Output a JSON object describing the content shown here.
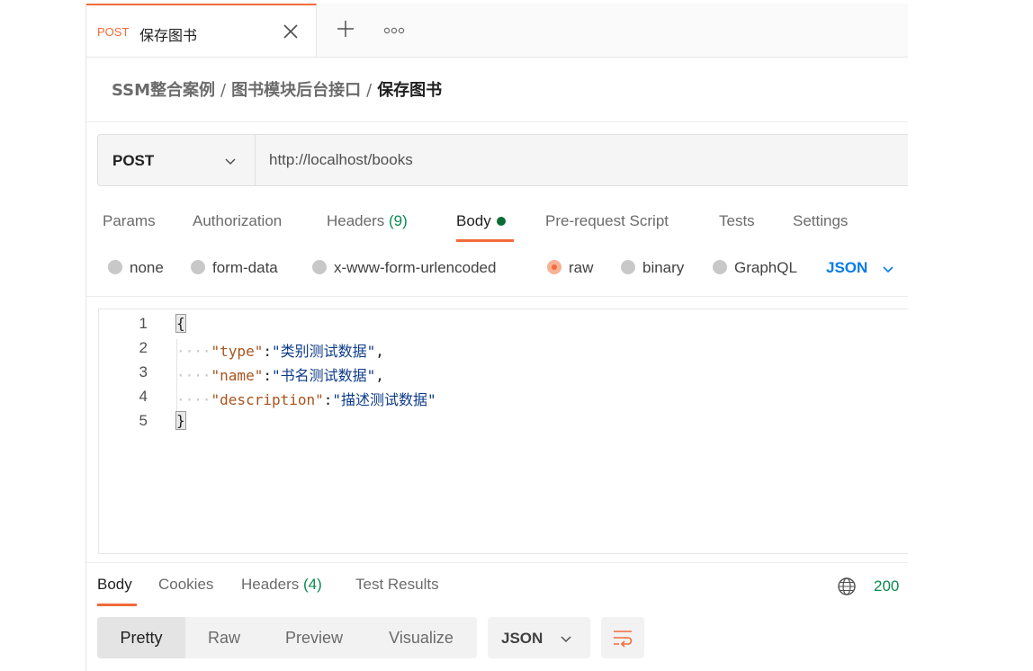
{
  "tab": {
    "method": "POST",
    "title": "保存图书"
  },
  "breadcrumb": {
    "items": [
      "SSM整合案例",
      "图书模块后台接口"
    ],
    "separator": "/",
    "current": "保存图书"
  },
  "request": {
    "method": "POST",
    "url": "http://localhost/books"
  },
  "request_tabs": {
    "params": "Params",
    "authorization": "Authorization",
    "headers": "Headers",
    "headers_count": "(9)",
    "body": "Body",
    "prerequest": "Pre-request Script",
    "tests": "Tests",
    "settings": "Settings"
  },
  "body_types": {
    "none": "none",
    "form_data": "form-data",
    "urlencoded": "x-www-form-urlencoded",
    "raw": "raw",
    "binary": "binary",
    "graphql": "GraphQL",
    "format": "JSON"
  },
  "editor": {
    "lines": [
      {
        "num": "1",
        "open": "{"
      },
      {
        "num": "2",
        "guide": "····",
        "key": "\"type\"",
        "colon": ":",
        "value": "\"类别测试数据\"",
        "comma": ","
      },
      {
        "num": "3",
        "guide": "····",
        "key": "\"name\"",
        "colon": ":",
        "value": "\"书名测试数据\"",
        "comma": ","
      },
      {
        "num": "4",
        "guide": "····",
        "key": "\"description\"",
        "colon": ":",
        "value": "\"描述测试数据\"",
        "comma": ""
      },
      {
        "num": "5",
        "close": "}"
      }
    ]
  },
  "response_tabs": {
    "body": "Body",
    "cookies": "Cookies",
    "headers": "Headers",
    "headers_count": "(4)",
    "test_results": "Test Results",
    "status": "200"
  },
  "view": {
    "pretty": "Pretty",
    "raw": "Raw",
    "preview": "Preview",
    "visualize": "Visualize",
    "format": "JSON"
  },
  "colors": {
    "accent": "#f26b3a",
    "link_blue": "#097bed",
    "success_green": "#0b8a4f"
  }
}
